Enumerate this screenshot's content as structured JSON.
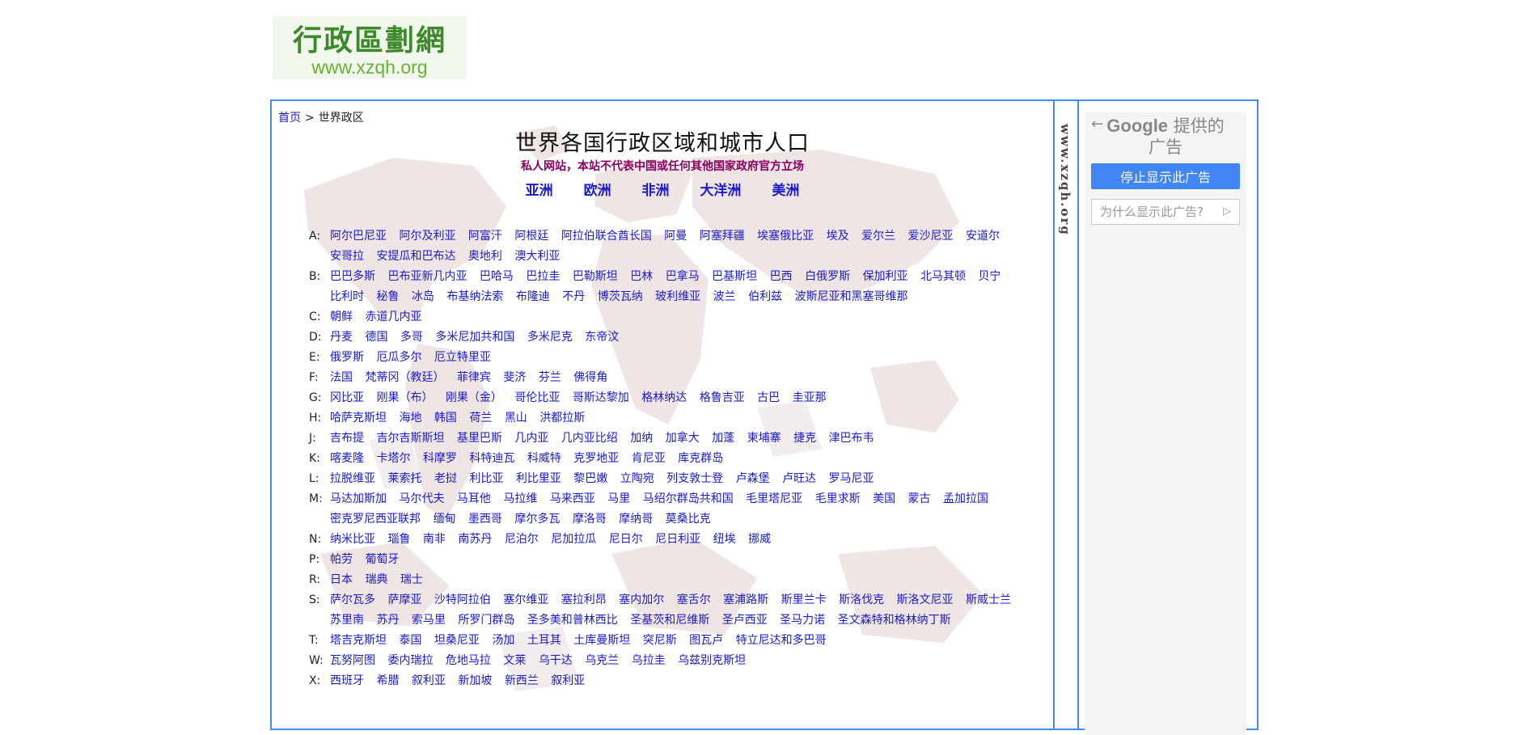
{
  "logo": {
    "chinese": "行政區劃網",
    "url": "www.xzqh.org"
  },
  "breadcrumb": {
    "home": "首页",
    "separator": ">",
    "current": "世界政区"
  },
  "page": {
    "title": "世界各国行政区域和城市人口",
    "subtitle": "私人网站，本站不代表中国或任何其他国家政府官方立场"
  },
  "continents": [
    "亚洲",
    "欧洲",
    "非洲",
    "大洋洲",
    "美洲"
  ],
  "country_groups": [
    {
      "letter": "A:",
      "countries": [
        "阿尔巴尼亚",
        "阿尔及利亚",
        "阿富汗",
        "阿根廷",
        "阿拉伯联合酋长国",
        "阿曼",
        "阿塞拜疆",
        "埃塞俄比亚",
        "埃及",
        "爱尔兰",
        "爱沙尼亚",
        "安道尔",
        "安哥拉",
        "安提瓜和巴布达",
        "奥地利",
        "澳大利亚"
      ]
    },
    {
      "letter": "B:",
      "countries": [
        "巴巴多斯",
        "巴布亚新几内亚",
        "巴哈马",
        "巴拉圭",
        "巴勒斯坦",
        "巴林",
        "巴拿马",
        "巴基斯坦",
        "巴西",
        "白俄罗斯",
        "保加利亚",
        "北马其顿",
        "贝宁",
        "比利时",
        "秘鲁",
        "冰岛",
        "布基纳法索",
        "布隆迪",
        "不丹",
        "博茨瓦纳",
        "玻利维亚",
        "波兰",
        "伯利兹",
        "波斯尼亚和黑塞哥维那"
      ]
    },
    {
      "letter": "C:",
      "countries": [
        "朝鲜",
        "赤道几内亚"
      ]
    },
    {
      "letter": "D:",
      "countries": [
        "丹麦",
        "德国",
        "多哥",
        "多米尼加共和国",
        "多米尼克",
        "东帝汶"
      ]
    },
    {
      "letter": "E:",
      "countries": [
        "俄罗斯",
        "厄瓜多尔",
        "厄立特里亚"
      ]
    },
    {
      "letter": "F:",
      "countries": [
        "法国",
        "梵蒂冈（教廷）",
        "菲律宾",
        "斐济",
        "芬兰",
        "佛得角"
      ]
    },
    {
      "letter": "G:",
      "countries": [
        "冈比亚",
        "刚果（布）",
        "刚果（金）",
        "哥伦比亚",
        "哥斯达黎加",
        "格林纳达",
        "格鲁吉亚",
        "古巴",
        "圭亚那"
      ]
    },
    {
      "letter": "H:",
      "countries": [
        "哈萨克斯坦",
        "海地",
        "韩国",
        "荷兰",
        "黑山",
        "洪都拉斯"
      ]
    },
    {
      "letter": "J:",
      "countries": [
        "吉布提",
        "吉尔吉斯斯坦",
        "基里巴斯",
        "几内亚",
        "几内亚比绍",
        "加纳",
        "加拿大",
        "加蓬",
        "柬埔寨",
        "捷克",
        "津巴布韦"
      ]
    },
    {
      "letter": "K:",
      "countries": [
        "喀麦隆",
        "卡塔尔",
        "科摩罗",
        "科特迪瓦",
        "科威特",
        "克罗地亚",
        "肯尼亚",
        "库克群岛"
      ]
    },
    {
      "letter": "L:",
      "countries": [
        "拉脱维亚",
        "莱索托",
        "老挝",
        "利比亚",
        "利比里亚",
        "黎巴嫩",
        "立陶宛",
        "列支敦士登",
        "卢森堡",
        "卢旺达",
        "罗马尼亚"
      ]
    },
    {
      "letter": "M:",
      "countries": [
        "马达加斯加",
        "马尔代夫",
        "马耳他",
        "马拉维",
        "马来西亚",
        "马里",
        "马绍尔群岛共和国",
        "毛里塔尼亚",
        "毛里求斯",
        "美国",
        "蒙古",
        "孟加拉国",
        "密克罗尼西亚联邦",
        "缅甸",
        "墨西哥",
        "摩尔多瓦",
        "摩洛哥",
        "摩纳哥",
        "莫桑比克"
      ]
    },
    {
      "letter": "N:",
      "countries": [
        "纳米比亚",
        "瑙鲁",
        "南非",
        "南苏丹",
        "尼泊尔",
        "尼加拉瓜",
        "尼日尔",
        "尼日利亚",
        "纽埃",
        "挪威"
      ]
    },
    {
      "letter": "P:",
      "countries": [
        "帕劳",
        "葡萄牙"
      ]
    },
    {
      "letter": "R:",
      "countries": [
        "日本",
        "瑞典",
        "瑞士"
      ]
    },
    {
      "letter": "S:",
      "countries": [
        "萨尔瓦多",
        "萨摩亚",
        "沙特阿拉伯",
        "塞尔维亚",
        "塞拉利昂",
        "塞内加尔",
        "塞舌尔",
        "塞浦路斯",
        "斯里兰卡",
        "斯洛伐克",
        "斯洛文尼亚",
        "斯威士兰",
        "苏里南",
        "苏丹",
        "索马里",
        "所罗门群岛",
        "圣多美和普林西比",
        "圣基茨和尼维斯",
        "圣卢西亚",
        "圣马力诺",
        "圣文森特和格林纳丁斯"
      ]
    },
    {
      "letter": "T:",
      "countries": [
        "塔吉克斯坦",
        "泰国",
        "坦桑尼亚",
        "汤加",
        "土耳其",
        "土库曼斯坦",
        "突尼斯",
        "图瓦卢",
        "特立尼达和多巴哥"
      ]
    },
    {
      "letter": "W:",
      "countries": [
        "瓦努阿图",
        "委内瑞拉",
        "危地马拉",
        "文莱",
        "乌干达",
        "乌克兰",
        "乌拉圭",
        "乌兹别克斯坦"
      ]
    },
    {
      "letter": "X:",
      "countries": [
        "西班牙",
        "希腊",
        "叙利亚",
        "新加坡",
        "新西兰",
        "叙利亚"
      ]
    }
  ],
  "side_strip": {
    "text": "www.xzqh.org"
  },
  "ad": {
    "google": "Google",
    "provided": "提供的",
    "ad_word": "广告",
    "stop_button": "停止显示此广告",
    "why_button": "为什么显示此广告?",
    "back_icon": "arrow-left-icon",
    "play_icon": "adchoices-icon"
  },
  "colors": {
    "frame_border": "#3f8ef0",
    "link": "#1a1acc",
    "subtitle": "#8b0060",
    "logo_green": "#3d8a2a",
    "ad_button": "#4285f4"
  }
}
